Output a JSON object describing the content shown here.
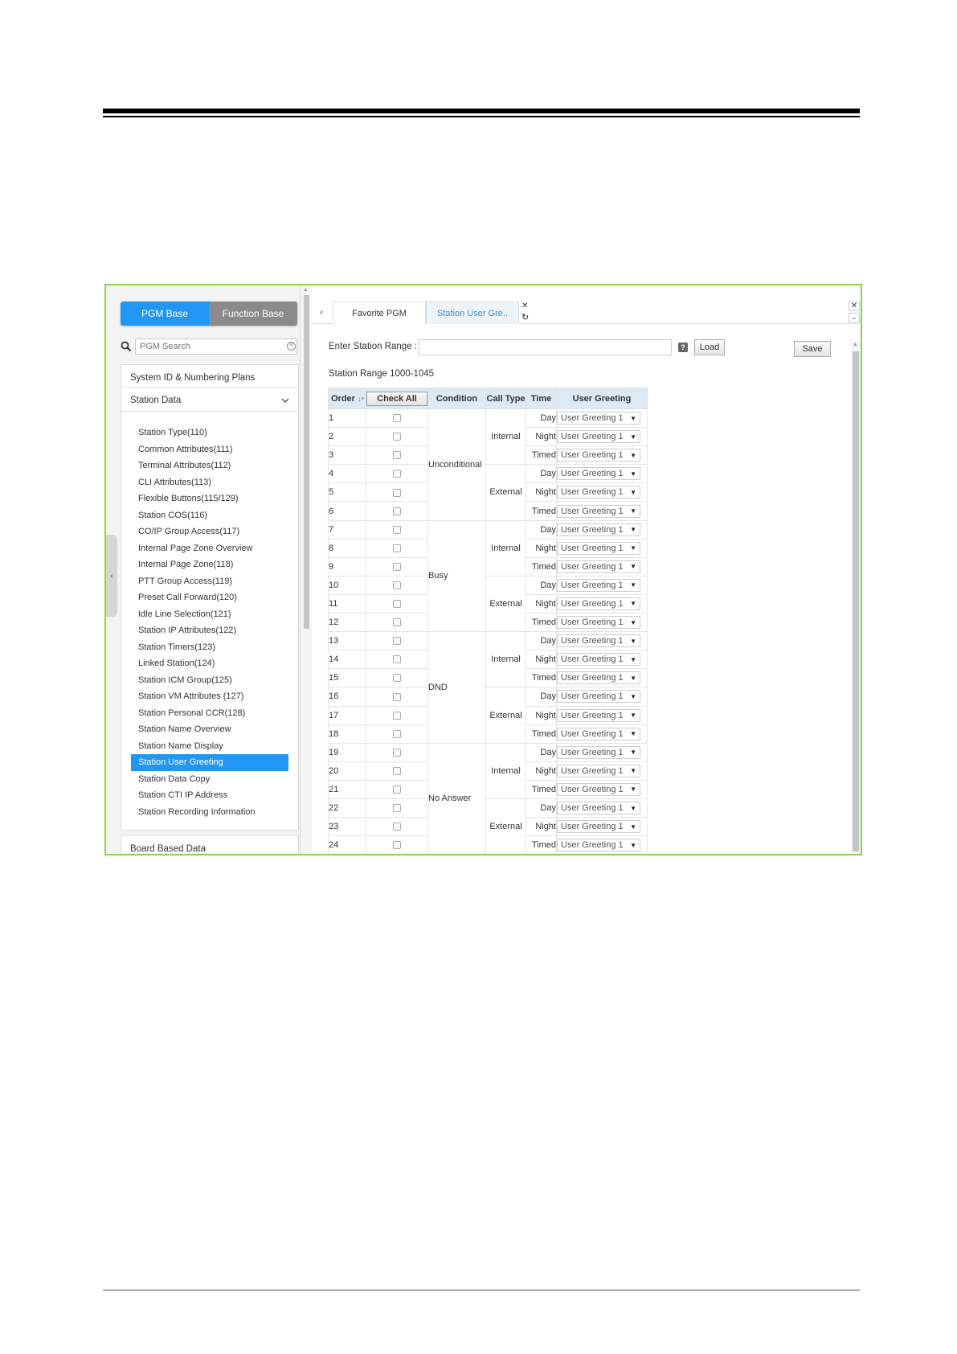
{
  "left_panel": {
    "tabs": {
      "pgm_base": "PGM Base",
      "function_base": "Function Base"
    },
    "search_placeholder": "PGM Search",
    "sections": {
      "system_id": "System ID & Numbering Plans",
      "station_data": "Station Data",
      "board_based": "Board Based Data"
    },
    "station_items": [
      "Station Type(110)",
      "Common Attributes(111)",
      "Terminal Attributes(112)",
      "CLI Attributes(113)",
      "Flexible Buttons(115/129)",
      "Station COS(116)",
      "CO/IP Group Access(117)",
      "Internal Page Zone Overview",
      "Internal Page Zone(118)",
      "PTT Group Access(119)",
      "Preset Call Forward(120)",
      "Idle Line Selection(121)",
      "Station IP Attributes(122)",
      "Station Timers(123)",
      "Linked Station(124)",
      "Station ICM Group(125)",
      "Station VM Attributes (127)",
      "Station Personal CCR(128)",
      "Station Name Overview",
      "Station Name Display",
      "Station User Greeting",
      "Station Data Copy",
      "Station CTI IP Address",
      "Station Recording Information"
    ],
    "active_index": 20
  },
  "tabs": {
    "favorite": "Favorite PGM",
    "current": "Station User Gre.."
  },
  "form": {
    "range_label": "Enter Station Range :",
    "range_value": "",
    "load_label": "Load",
    "save_label": "Save",
    "range_info": "Station Range 1000-1045"
  },
  "table": {
    "headers": {
      "order": "Order",
      "check_all": "Check All",
      "condition": "Condition",
      "call_type": "Call Type",
      "time": "Time",
      "user_greeting": "User Greeting"
    },
    "conditions": [
      "Unconditional",
      "Busy",
      "DND",
      "No Answer"
    ],
    "call_types": [
      "Internal",
      "External"
    ],
    "times": [
      "Day",
      "Night",
      "Timed"
    ],
    "greeting_value": "User Greeting 1",
    "orders": [
      "1",
      "2",
      "3",
      "4",
      "5",
      "6",
      "7",
      "8",
      "9",
      "10",
      "11",
      "12",
      "13",
      "14",
      "15",
      "16",
      "17",
      "18",
      "19",
      "20",
      "21",
      "22",
      "23",
      "24"
    ]
  },
  "colors": {
    "accent": "#2196f3",
    "header_bg": "#dceaf5",
    "frame": "#8fd14f"
  }
}
